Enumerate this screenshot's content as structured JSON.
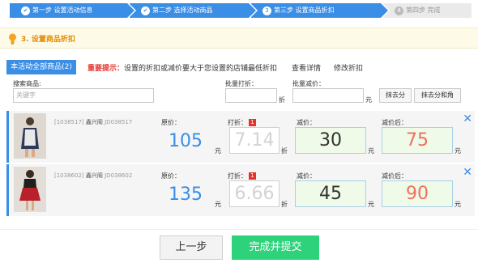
{
  "steps": [
    {
      "num": "✔",
      "label": "第一步 设置活动信息",
      "state": "done"
    },
    {
      "num": "✔",
      "label": "第二步 选择活动商品",
      "state": "done"
    },
    {
      "num": "3",
      "label": "第三步 设置商品折扣",
      "state": "active"
    },
    {
      "num": "4",
      "label": "第四步 完成",
      "state": "pending"
    }
  ],
  "section": {
    "title": "3. 设置商品折扣",
    "icon": "lightbulb-icon"
  },
  "tabs": {
    "all": "本活动全部商品(2)",
    "notice_label": "重要提示：",
    "notice_text": "设置的折扣或减价要大于您设置的店铺最低折扣",
    "details": "查看详情",
    "modify": "修改折扣"
  },
  "filters": {
    "search_label": "搜索商品:",
    "search_placeholder": "关键字",
    "batch_discount_label": "批量打折：",
    "batch_discount_unit": "折",
    "batch_reduce_label": "批量减价：",
    "batch_reduce_unit": "元",
    "btn_remove_fen": "抹去分",
    "btn_remove_fenjiao": "抹去分和角"
  },
  "labels": {
    "price": "原价：",
    "discount": "打折：",
    "reduce": "减价：",
    "after": "减价后：",
    "yuan": "元",
    "zhe": "折",
    "badge": "1"
  },
  "products": [
    {
      "id": "[1038517]",
      "shop": "鑫兴阁",
      "code": "JD038517",
      "price": "105",
      "discount": "7.14",
      "reduce": "30",
      "after": "75"
    },
    {
      "id": "[1038602]",
      "shop": "鑫兴阁",
      "code": "JD038602",
      "price": "135",
      "discount": "6.66",
      "reduce": "45",
      "after": "90"
    }
  ],
  "buttons": {
    "prev": "上一步",
    "submit": "完成并提交"
  },
  "colors": {
    "accent": "#3a8ee6",
    "submit": "#2ed27a",
    "warning": "#e5322d",
    "after_price": "#f0715a"
  }
}
